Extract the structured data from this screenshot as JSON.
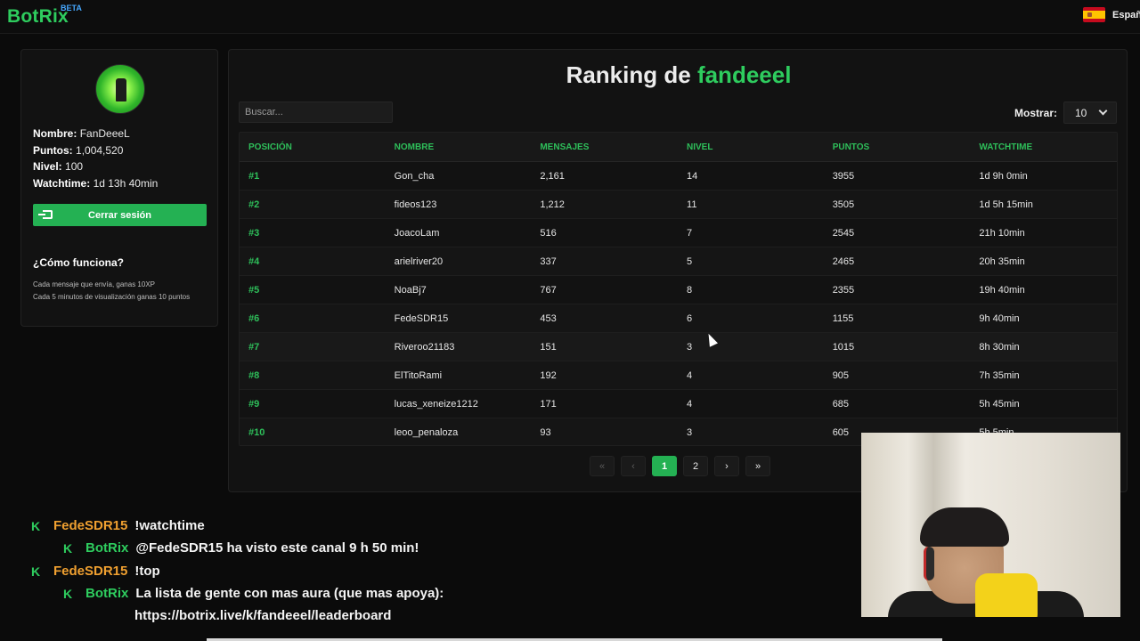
{
  "topbar": {
    "logo": "BotRix",
    "beta": "BETA",
    "language": "Españo"
  },
  "profile": {
    "name_label": "Nombre:",
    "name_value": "FanDeeeL",
    "points_label": "Puntos:",
    "points_value": "1,004,520",
    "level_label": "Nivel:",
    "level_value": "100",
    "watchtime_label": "Watchtime:",
    "watchtime_value": "1d 13h 40min",
    "logout_label": "Cerrar sesión",
    "how_title": "¿Cómo funciona?",
    "how_line1": "Cada mensaje que envía, ganas 10XP",
    "how_line2": "Cada 5 minutos de visualización ganas 10 puntos"
  },
  "main": {
    "title_prefix": "Ranking de",
    "title_channel": "fandeeel",
    "search_placeholder": "Buscar...",
    "show_label": "Mostrar:",
    "show_value": "10"
  },
  "table": {
    "headers": [
      "POSICIÓN",
      "NOMBRE",
      "MENSAJES",
      "NIVEL",
      "PUNTOS",
      "WATCHTIME"
    ],
    "rows": [
      [
        "#1",
        "Gon_cha",
        "2,161",
        "14",
        "3955",
        "1d 9h 0min"
      ],
      [
        "#2",
        "fideos123",
        "1,212",
        "11",
        "3505",
        "1d 5h 15min"
      ],
      [
        "#3",
        "JoacoLam",
        "516",
        "7",
        "2545",
        "21h 10min"
      ],
      [
        "#4",
        "arielriver20",
        "337",
        "5",
        "2465",
        "20h 35min"
      ],
      [
        "#5",
        "NoaBj7",
        "767",
        "8",
        "2355",
        "19h 40min"
      ],
      [
        "#6",
        "FedeSDR15",
        "453",
        "6",
        "1155",
        "9h 40min"
      ],
      [
        "#7",
        "Riveroo21183",
        "151",
        "3",
        "1015",
        "8h 30min"
      ],
      [
        "#8",
        "ElTitoRami",
        "192",
        "4",
        "905",
        "7h 35min"
      ],
      [
        "#9",
        "lucas_xeneize1212",
        "171",
        "4",
        "685",
        "5h 45min"
      ],
      [
        "#10",
        "leoo_penaloza",
        "93",
        "3",
        "605",
        "5h 5min"
      ]
    ]
  },
  "pagination": {
    "first": "«",
    "prev": "‹",
    "page1": "1",
    "page2": "2",
    "next": "›",
    "last": "»"
  },
  "chat": [
    {
      "user": "FedeSDR15",
      "text": "!watchtime"
    },
    {
      "user": "BotRix",
      "text": "@FedeSDR15 ha visto este canal 9 h 50 min!"
    },
    {
      "user": "FedeSDR15",
      "text": "!top"
    },
    {
      "user": "BotRix",
      "text": "La lista de gente con mas aura (que mas apoya):"
    },
    {
      "user": "",
      "text": "https://botrix.live/k/fandeeel/leaderboard"
    }
  ],
  "chat_badge": "K",
  "colors": {
    "accent": "#2ecc5e",
    "button": "#24b153",
    "chat_user": "#f0a030",
    "background": "#0b0b0b"
  }
}
